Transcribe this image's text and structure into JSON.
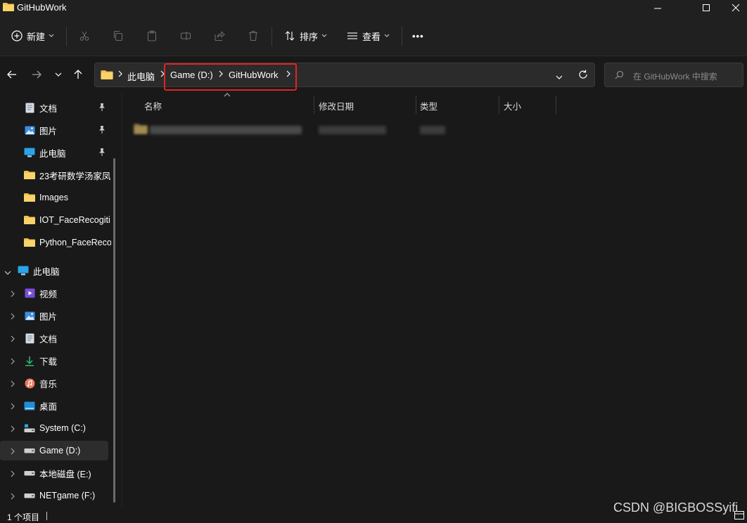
{
  "window": {
    "title": "GitHubWork"
  },
  "toolbar": {
    "new_label": "新建",
    "sort_label": "排序",
    "view_label": "查看",
    "more_label": "•••"
  },
  "address": {
    "crumbs": [
      "此电脑",
      "Game (D:)",
      "GitHubWork"
    ]
  },
  "search": {
    "placeholder": "在 GitHubWork 中搜索"
  },
  "sidebar": {
    "quick_access": [
      {
        "label": "文档",
        "icon": "document-icon",
        "pinned": true
      },
      {
        "label": "图片",
        "icon": "pictures-icon",
        "pinned": true
      },
      {
        "label": "此电脑",
        "icon": "this-pc-icon",
        "pinned": true
      },
      {
        "label": "23考研数学汤家凤",
        "icon": "folder-icon",
        "pinned": false
      },
      {
        "label": "Images",
        "icon": "folder-icon",
        "pinned": false
      },
      {
        "label": "IOT_FaceRecogiti",
        "icon": "folder-icon",
        "pinned": false
      },
      {
        "label": "Python_FaceReco",
        "icon": "folder-icon",
        "pinned": false
      }
    ],
    "this_pc": {
      "label": "此电脑",
      "children": [
        {
          "label": "视频",
          "icon": "videos-icon"
        },
        {
          "label": "图片",
          "icon": "pictures-icon"
        },
        {
          "label": "文档",
          "icon": "document-icon"
        },
        {
          "label": "下载",
          "icon": "download-icon"
        },
        {
          "label": "音乐",
          "icon": "music-icon"
        },
        {
          "label": "桌面",
          "icon": "desktop-icon"
        },
        {
          "label": "System (C:)",
          "icon": "system-drive-icon"
        },
        {
          "label": "Game (D:)",
          "icon": "drive-icon"
        },
        {
          "label": "本地磁盘 (E:)",
          "icon": "drive-icon"
        },
        {
          "label": "NETgame (F:)",
          "icon": "drive-icon"
        }
      ]
    }
  },
  "file_list": {
    "columns": [
      "名称",
      "修改日期",
      "类型",
      "大小"
    ]
  },
  "status": {
    "item_count": "1 个项目"
  },
  "watermark": "CSDN @BIGBOSSyifi",
  "colors": {
    "background": "#191919",
    "chrome": "#202020",
    "folder": "#f4c04e",
    "highlight_box": "#e02424"
  }
}
